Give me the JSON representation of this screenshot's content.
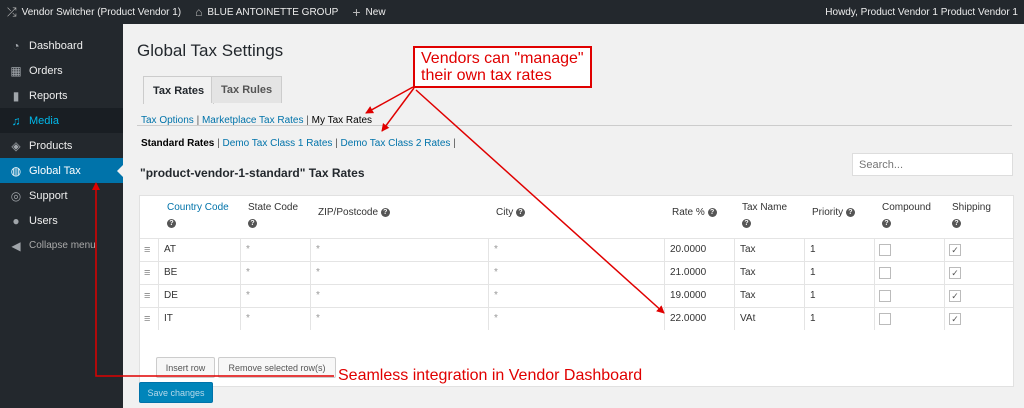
{
  "adminbar": {
    "switcher": "Vendor Switcher (Product Vendor 1)",
    "site": "BLUE ANTOINETTE GROUP",
    "new": "New",
    "howdy": "Howdy, Product Vendor 1 Product Vendor 1"
  },
  "sidebar": {
    "items": [
      {
        "label": "Dashboard",
        "icon": "dashboard-icon"
      },
      {
        "label": "Orders",
        "icon": "store-icon"
      },
      {
        "label": "Reports",
        "icon": "chart-icon"
      },
      {
        "label": "Media",
        "icon": "media-icon"
      },
      {
        "label": "Products",
        "icon": "box-icon"
      },
      {
        "label": "Global Tax",
        "icon": "globe-icon"
      },
      {
        "label": "Support",
        "icon": "support-icon"
      },
      {
        "label": "Users",
        "icon": "user-icon"
      },
      {
        "label": "Collapse menu",
        "icon": "collapse-icon"
      }
    ]
  },
  "page": {
    "title": "Global Tax Settings",
    "tabs": [
      "Tax Rates",
      "Tax Rules"
    ],
    "subnav1": [
      "Tax Options",
      "Marketplace Tax Rates",
      "My Tax Rates"
    ],
    "subnav2": [
      "Standard Rates",
      "Demo Tax Class 1 Rates",
      "Demo Tax Class 2 Rates"
    ],
    "search_placeholder": "Search...",
    "rates_heading": "\"product-vendor-1-standard\" Tax Rates"
  },
  "table": {
    "headers": [
      "Country Code",
      "State Code",
      "ZIP/Postcode",
      "City",
      "Rate %",
      "Tax Name",
      "Priority",
      "Compound",
      "Shipping"
    ],
    "rows": [
      {
        "country": "AT",
        "state": "*",
        "zip": "*",
        "city": "*",
        "rate": "20.0000",
        "name": "Tax",
        "priority": "1",
        "compound": false,
        "shipping": true
      },
      {
        "country": "BE",
        "state": "*",
        "zip": "*",
        "city": "*",
        "rate": "21.0000",
        "name": "Tax",
        "priority": "1",
        "compound": false,
        "shipping": true
      },
      {
        "country": "DE",
        "state": "*",
        "zip": "*",
        "city": "*",
        "rate": "19.0000",
        "name": "Tax",
        "priority": "1",
        "compound": false,
        "shipping": true
      },
      {
        "country": "IT",
        "state": "*",
        "zip": "*",
        "city": "*",
        "rate": "22.0000",
        "name": "VAt",
        "priority": "1",
        "compound": false,
        "shipping": true
      }
    ],
    "insert_row": "Insert row",
    "remove_rows": "Remove selected row(s)"
  },
  "save_changes": "Save changes",
  "annotations": {
    "top_line1": "Vendors can \"manage\"",
    "top_line2": "their own tax rates",
    "bottom": "Seamless integration in Vendor Dashboard",
    "color": "#e00000"
  },
  "colors": {
    "admin_bg": "#23282d",
    "accent": "#0073aa",
    "page_bg": "#f1f1f1"
  }
}
